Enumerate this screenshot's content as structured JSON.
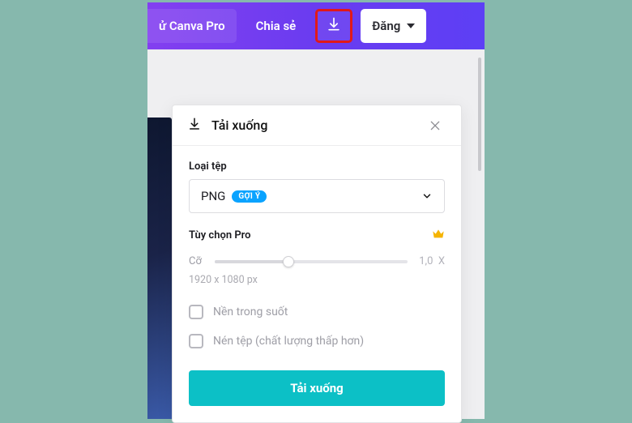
{
  "topbar": {
    "tryPro": "ử Canva Pro",
    "share": "Chia sẻ",
    "download_icon": "download-icon",
    "login": "Đăng"
  },
  "panel": {
    "title": "Tải xuống",
    "filetype_label": "Loại tệp",
    "filetype_value": "PNG",
    "badge": "GỢI Ý",
    "pro_label": "Tùy chọn Pro",
    "size_label": "Cỡ",
    "size_value": "1,0",
    "size_suffix": "X",
    "dimensions": "1920 x 1080 px",
    "opt_transparent": "Nền trong suốt",
    "opt_compress": "Nén tệp (chất lượng thấp hơn)",
    "download_btn": "Tải xuống"
  }
}
